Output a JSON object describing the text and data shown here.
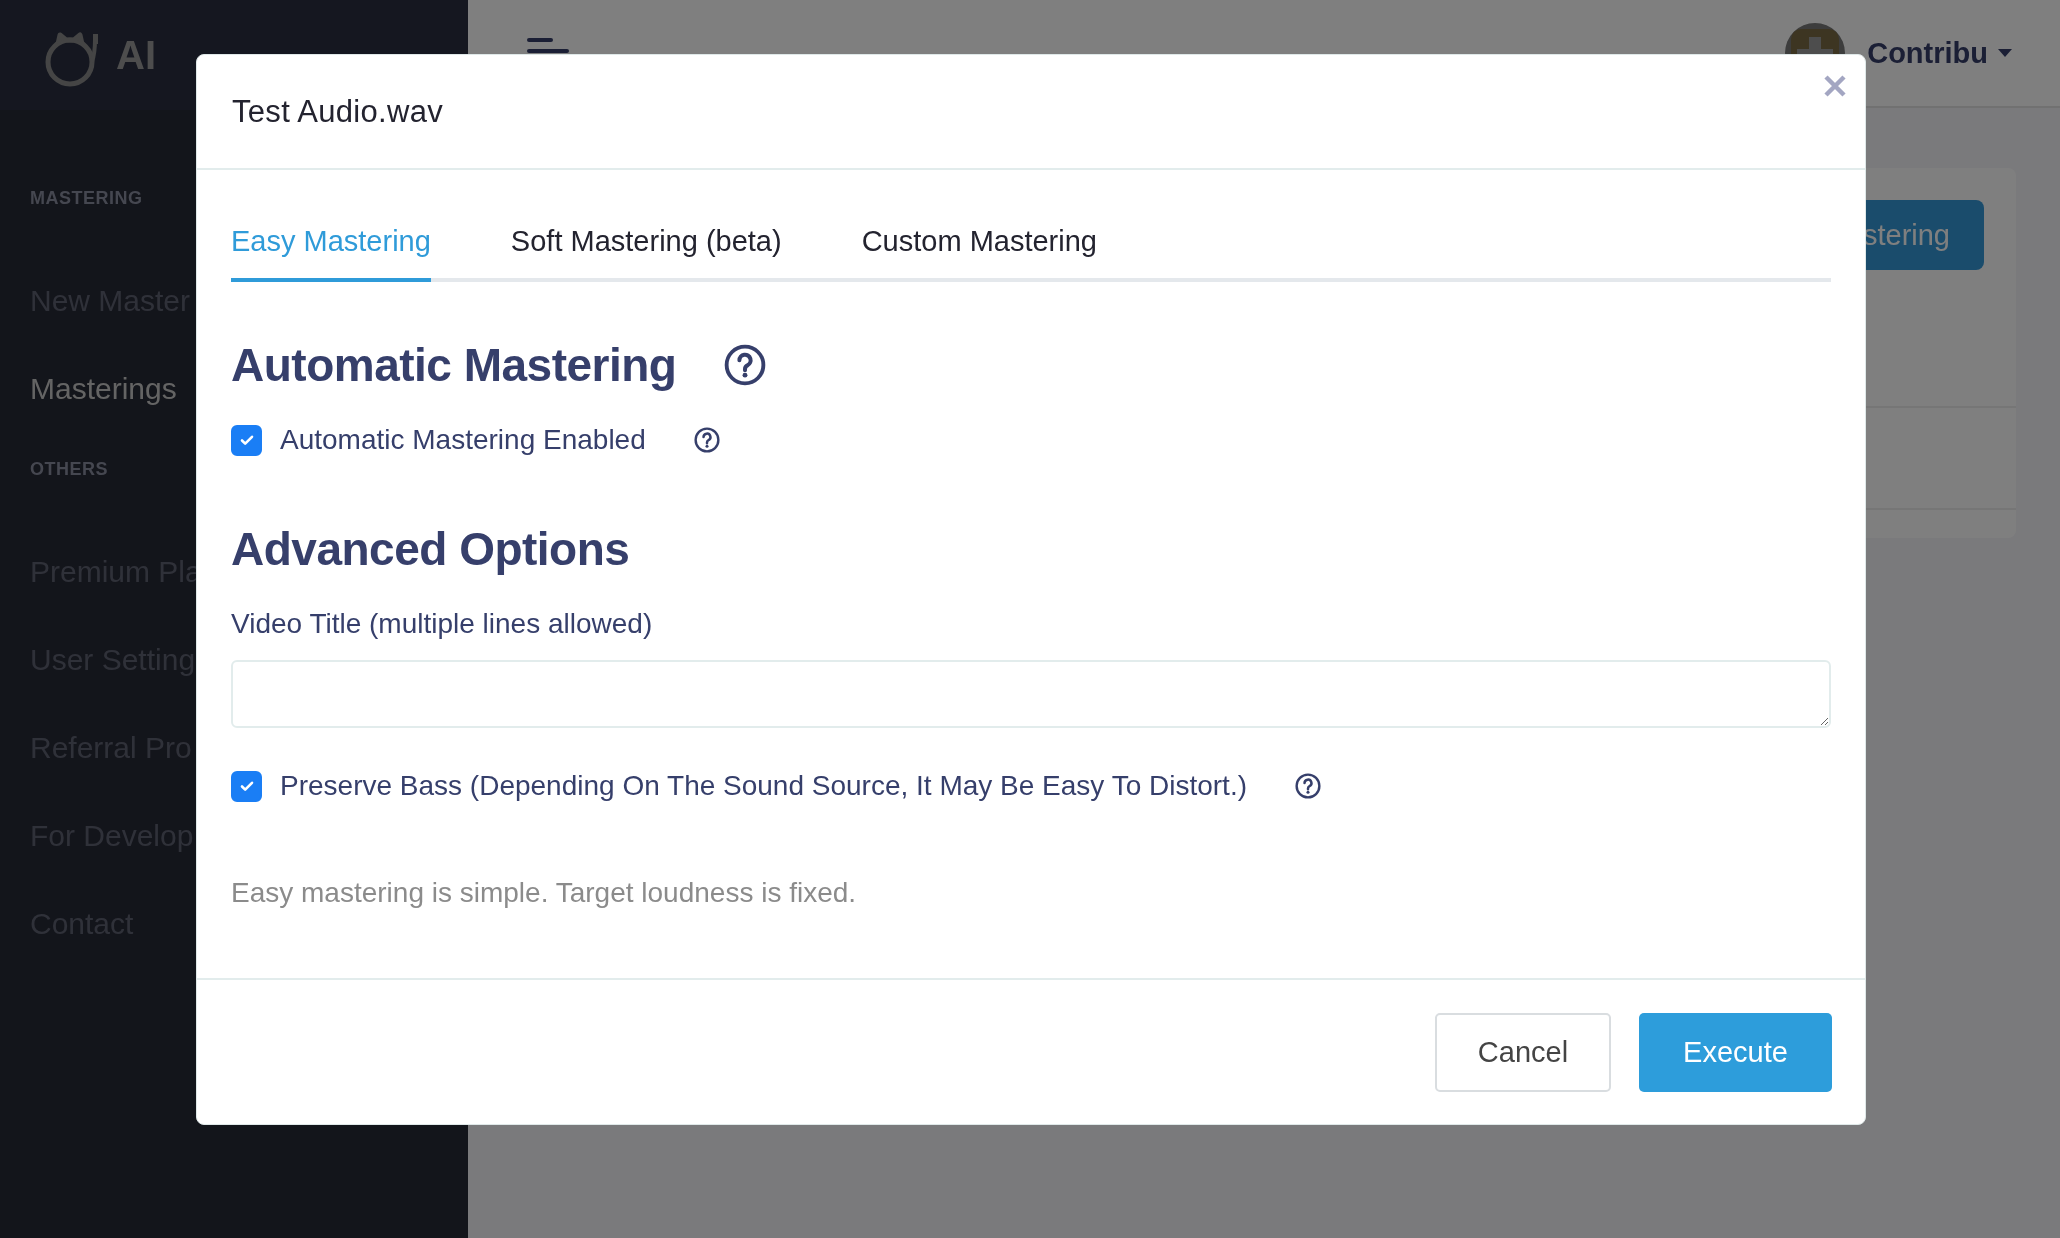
{
  "sidebar": {
    "logo": "AI",
    "sections": [
      {
        "heading": "MASTERING",
        "items": [
          {
            "label": "New Master",
            "selected": false
          },
          {
            "label": "Masterings",
            "selected": true
          }
        ]
      },
      {
        "heading": "OTHERS",
        "items": [
          {
            "label": "Premium Pla",
            "selected": false
          },
          {
            "label": "User Setting",
            "selected": false
          },
          {
            "label": "Referral Pro",
            "selected": false
          },
          {
            "label": "For Develop",
            "selected": false
          },
          {
            "label": "Contact",
            "selected": false
          }
        ]
      }
    ]
  },
  "topbar": {
    "user": "Contribu"
  },
  "page": {
    "button": "stering"
  },
  "modal": {
    "title": "Test Audio.wav",
    "tabs": [
      {
        "label": "Easy Mastering",
        "selected": true
      },
      {
        "label": "Soft Mastering (beta)",
        "selected": false
      },
      {
        "label": "Custom Mastering",
        "selected": false
      }
    ],
    "automatic": {
      "heading": "Automatic Mastering",
      "checkbox": {
        "label": "Automatic Mastering Enabled",
        "checked": true
      }
    },
    "advanced": {
      "heading": "Advanced Options",
      "video_title_label": "Video Title (multiple lines allowed)",
      "preserve_bass": {
        "label": "Preserve Bass (Depending On The Sound Source, It May Be Easy To Distort.)",
        "checked": true
      }
    },
    "note": "Easy mastering is simple. Target loudness is fixed.",
    "buttons": [
      {
        "label": "Cancel",
        "kind": "secondary"
      },
      {
        "label": "Execute",
        "kind": "primary"
      }
    ]
  }
}
